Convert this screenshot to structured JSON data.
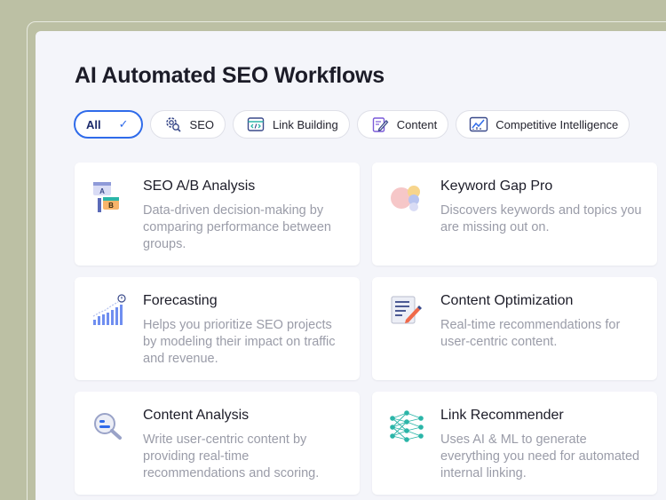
{
  "page": {
    "title": "AI Automated SEO Workflows"
  },
  "filters": [
    {
      "label": "All",
      "icon": "check-icon",
      "active": true
    },
    {
      "label": "SEO",
      "icon": "gear-search-icon",
      "active": false
    },
    {
      "label": "Link Building",
      "icon": "code-window-icon",
      "active": false
    },
    {
      "label": "Content",
      "icon": "edit-document-icon",
      "active": false
    },
    {
      "label": "Competitive Intelligence",
      "icon": "chart-trend-icon",
      "active": false
    }
  ],
  "cards": [
    {
      "title": "SEO A/B Analysis",
      "description": "Data-driven decision-making by comparing performance between groups.",
      "icon": "ab-test-icon"
    },
    {
      "title": "Keyword Gap Pro",
      "description": "Discovers keywords and topics you are missing out on.",
      "icon": "keyword-gap-icon"
    },
    {
      "title": "Forecasting",
      "description": "Helps you prioritize SEO projects by modeling their impact on traffic and revenue.",
      "icon": "forecast-chart-icon"
    },
    {
      "title": "Content Optimization",
      "description": "Real-time recommendations for user-centric content.",
      "icon": "document-edit-icon"
    },
    {
      "title": "Content Analysis",
      "description": "Write user-centric content by providing real-time recommendations and scoring.",
      "icon": "magnifier-icon"
    },
    {
      "title": "Link Recommender",
      "description": "Uses AI & ML to generate everything you need for automated internal linking.",
      "icon": "neural-network-icon"
    }
  ],
  "colors": {
    "accent": "#2f6bea",
    "background": "#bcc0a4",
    "panel": "#f4f5fa"
  }
}
